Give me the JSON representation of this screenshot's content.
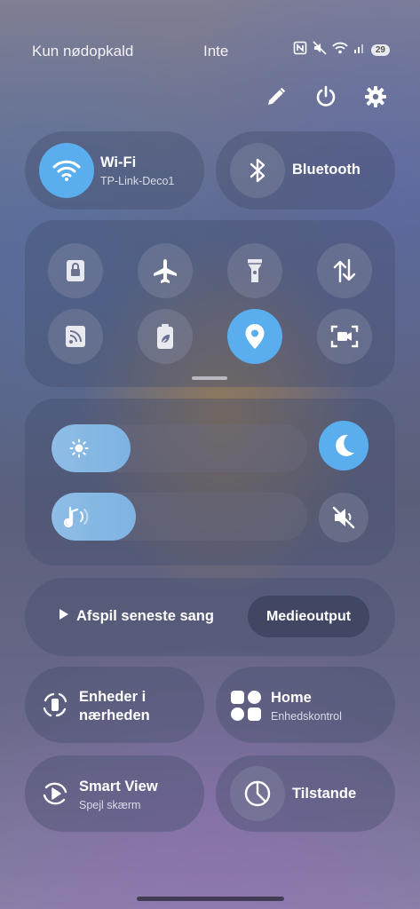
{
  "status_bar": {
    "carrier": "Kun nødopkald",
    "network": "Inte",
    "battery": "29",
    "icons": [
      "nfc-icon",
      "mute-icon",
      "wifi-icon",
      "signal-icon"
    ]
  },
  "header_actions": [
    "edit-icon",
    "power-icon",
    "settings-icon"
  ],
  "connectivity": {
    "wifi": {
      "label": "Wi-Fi",
      "sub": "TP-Link-Deco1",
      "active": true
    },
    "bluetooth": {
      "label": "Bluetooth",
      "active": false
    }
  },
  "quick_toggles": [
    {
      "name": "lock-rotation",
      "icon": "portrait-lock-icon",
      "active": false
    },
    {
      "name": "airplane-mode",
      "icon": "airplane-icon",
      "active": false
    },
    {
      "name": "flashlight",
      "icon": "flashlight-icon",
      "active": false
    },
    {
      "name": "mobile-data",
      "icon": "data-transfer-icon",
      "active": false
    },
    {
      "name": "nfc",
      "icon": "nfc-card-icon",
      "active": false
    },
    {
      "name": "power-saving",
      "icon": "battery-leaf-icon",
      "active": false
    },
    {
      "name": "location",
      "icon": "location-pin-icon",
      "active": true
    },
    {
      "name": "screen-recorder",
      "icon": "screen-record-icon",
      "active": false
    }
  ],
  "sliders": {
    "brightness": {
      "value": 0.31,
      "icon": "sun-icon"
    },
    "volume": {
      "value": 0.33,
      "icon": "volume-icon"
    },
    "dark_mode": {
      "icon": "moon-icon",
      "active": true
    },
    "mute": {
      "icon": "mute-icon",
      "active": false
    }
  },
  "media": {
    "play_label": "Afspil seneste sang",
    "output_label": "Medieoutput"
  },
  "tiles": {
    "nearby": {
      "label": "Enheder i nærheden",
      "line1": "Enheder i",
      "line2": "nærheden"
    },
    "home": {
      "label": "Home",
      "sub": "Enhedskontrol"
    },
    "smart_view": {
      "label": "Smart View",
      "sub": "Spejl skærm"
    },
    "modes": {
      "label": "Tilstande"
    }
  },
  "colors": {
    "accent": "#5aaeee",
    "slider_fill": "#8ebde6"
  }
}
